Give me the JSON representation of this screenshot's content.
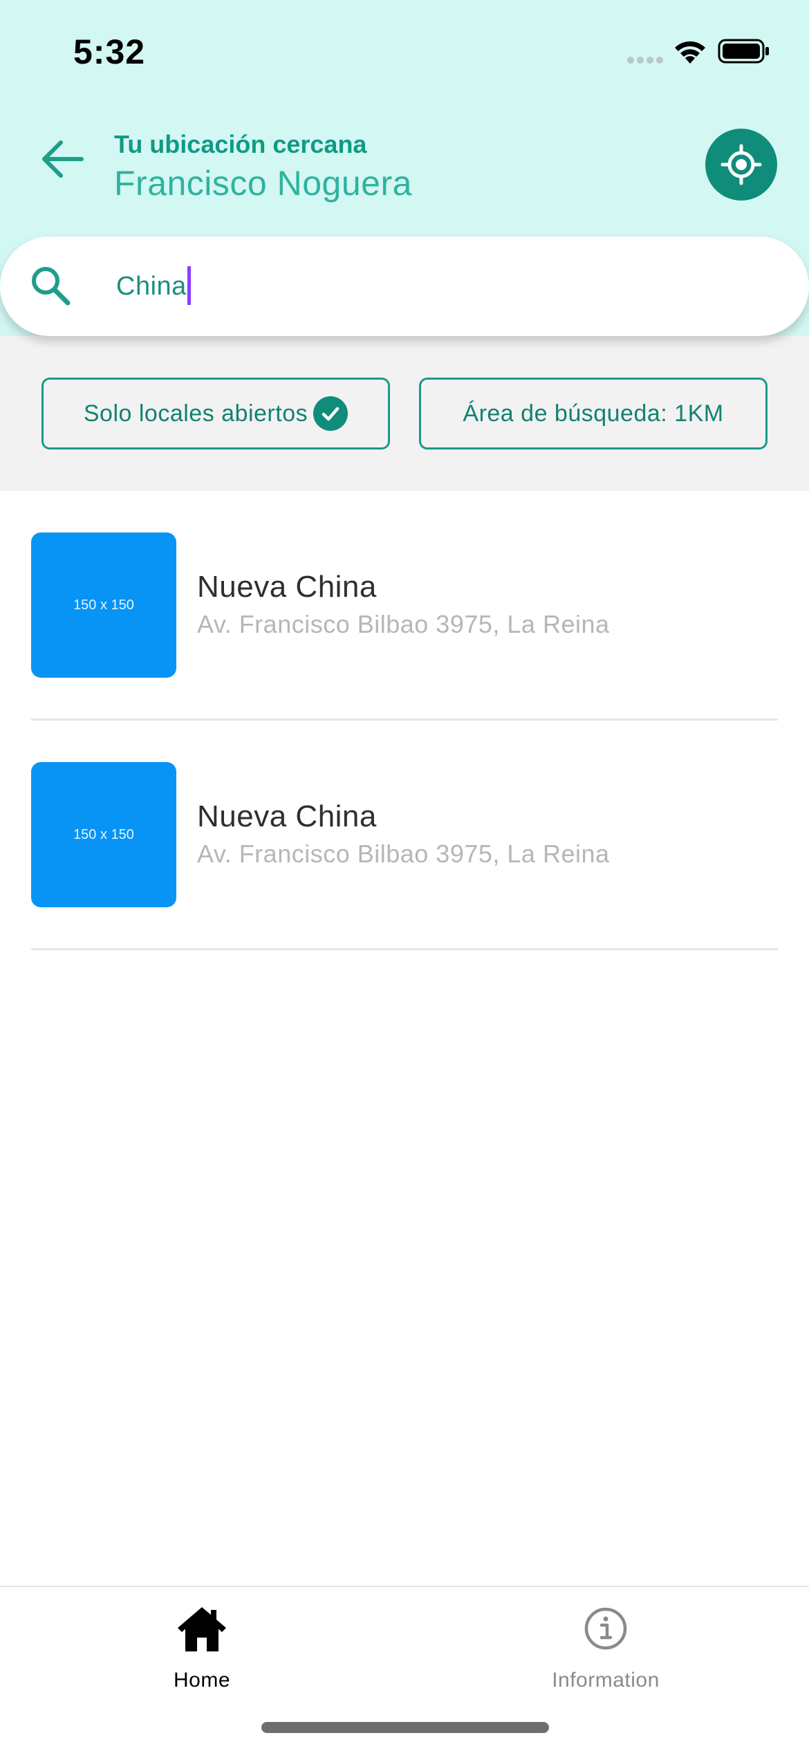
{
  "status_bar": {
    "time": "5:32"
  },
  "header": {
    "location_label": "Tu ubicación cercana",
    "location_name": "Francisco Noguera"
  },
  "search": {
    "value": "China"
  },
  "filters": {
    "open_only_label": "Solo locales abiertos",
    "open_only_checked": true,
    "area_label": "Área de búsqueda: 1KM"
  },
  "results": [
    {
      "thumbnail_text": "150 x 150",
      "name": "Nueva China",
      "address": "Av. Francisco Bilbao 3975, La Reina"
    },
    {
      "thumbnail_text": "150 x 150",
      "name": "Nueva China",
      "address": "Av. Francisco Bilbao 3975, La Reina"
    }
  ],
  "tabbar": {
    "home_label": "Home",
    "info_label": "Information",
    "active_tab": "home"
  },
  "colors": {
    "header_bg": "#d3f7f2",
    "brand_teal": "#0f8d7a",
    "thumbnail_blue": "#0894f4",
    "caret_purple": "#8b3dff"
  }
}
